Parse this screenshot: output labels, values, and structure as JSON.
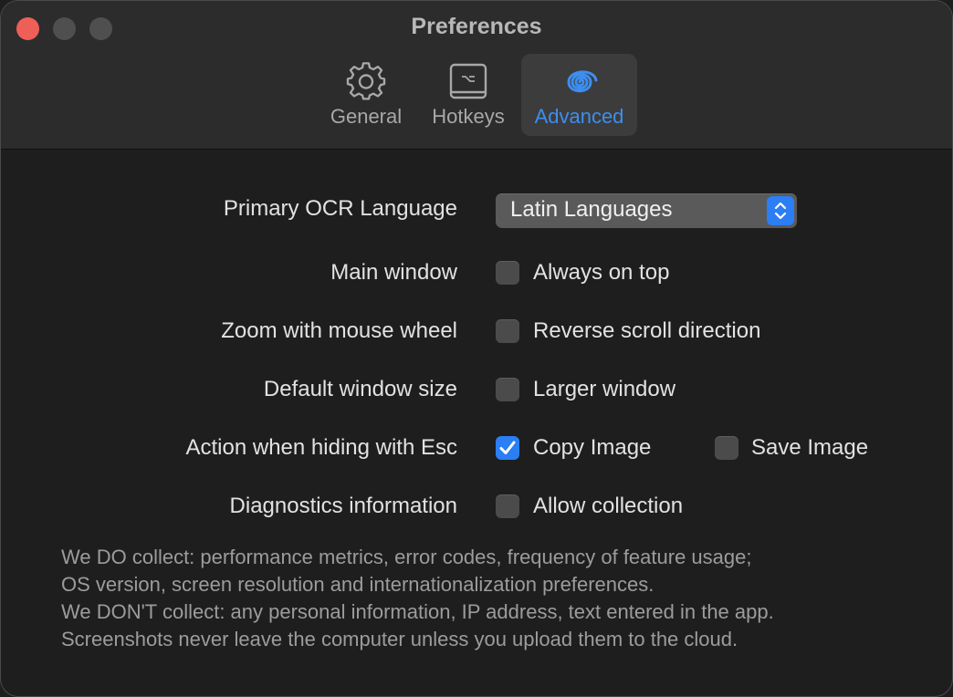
{
  "window": {
    "title": "Preferences"
  },
  "tabs": [
    {
      "label": "General",
      "icon": "gear-icon",
      "active": false
    },
    {
      "label": "Hotkeys",
      "icon": "keyboard-icon",
      "active": false
    },
    {
      "label": "Advanced",
      "icon": "spiral-icon",
      "active": true
    }
  ],
  "settings": {
    "ocr_language": {
      "label": "Primary OCR Language",
      "selected": "Latin Languages"
    },
    "main_window": {
      "label": "Main window",
      "option": "Always on top",
      "checked": false
    },
    "zoom": {
      "label": "Zoom with mouse wheel",
      "option": "Reverse scroll direction",
      "checked": false
    },
    "window_size": {
      "label": "Default window size",
      "option": "Larger window",
      "checked": false
    },
    "esc_action": {
      "label": "Action when hiding with Esc",
      "option1": "Copy Image",
      "option1_checked": true,
      "option2": "Save Image",
      "option2_checked": false
    },
    "diagnostics": {
      "label": "Diagnostics information",
      "option": "Allow collection",
      "checked": false
    }
  },
  "note": {
    "line1": "We DO collect: performance metrics, error codes, frequency of feature usage;",
    "line2": "OS version, screen resolution and internationalization preferences.",
    "line3": "We DON'T collect: any personal information, IP address, text entered in the app.",
    "line4": "Screenshots never leave the computer unless you upload them to the cloud."
  },
  "colors": {
    "accent": "#3d8ef0",
    "close": "#ee5f58"
  }
}
